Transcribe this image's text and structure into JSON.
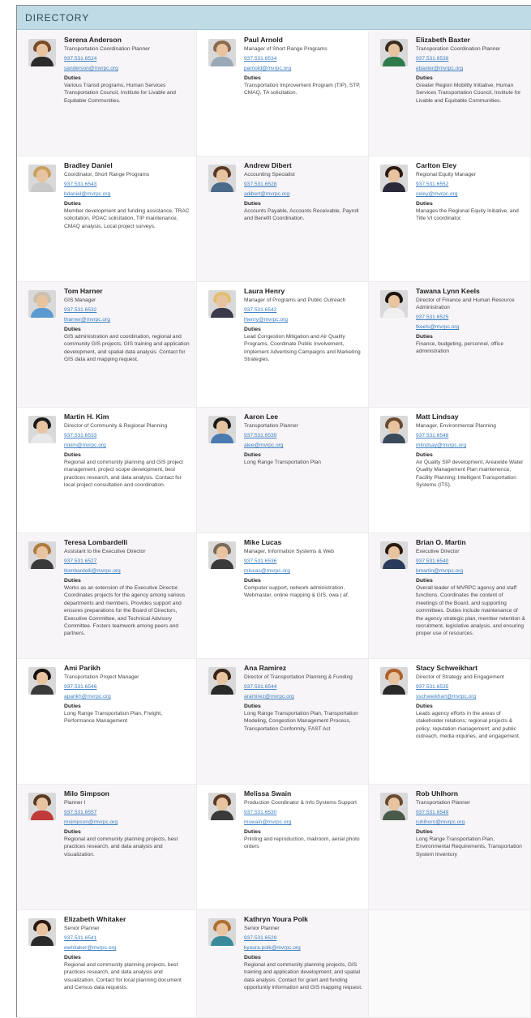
{
  "header": {
    "title": "DIRECTORY"
  },
  "people": [
    {
      "name": "Serena Anderson",
      "title": "Transportation Coordination Planner",
      "phone": "937.531.6524",
      "email": "sanderson@mvrpc.org",
      "duties_label": "Duties",
      "duties": "Various Transit programs, Human Services Transportation Council, Institute for Livable and Equitable Communities.",
      "hair": "#7a4a2a",
      "shirt": "#2b2b2b"
    },
    {
      "name": "Paul Arnold",
      "title": "Manager of Short Range Programs",
      "phone": "937.531.6534",
      "email": "parnold@mvrpc.org",
      "duties_label": "Duties",
      "duties": "Transportation Improvement Program (TIP), STP, CMAQ, TA solicitation.",
      "hair": "#8a6a50",
      "shirt": "#9aa9b8"
    },
    {
      "name": "Elizabeth Baxter",
      "title": "Transporation Coordination Planner",
      "phone": "937.531.6538",
      "email": "ebaxter@mvrpc.org",
      "duties_label": "Duties",
      "duties": "Greater Region Mobility Initiative, Human Services Transportation Council, Institute for Livable and Equitable Communities.",
      "hair": "#3a2a20",
      "shirt": "#2f7a4a"
    },
    {
      "name": "Bradley Daniel",
      "title": "Coordinator, Short Range Programs",
      "phone": "937.531.6543",
      "email": "bdaniel@mvrpc.org",
      "duties_label": "Duties",
      "duties": "Member development and funding assistance, TRAC solicitation, PDAC solicitation, TIP maintenance, CMAQ analysis, Local project surveys.",
      "hair": "#c9a060",
      "shirt": "#c9c9c9"
    },
    {
      "name": "Andrew Dibert",
      "title": "Accounting Specialist",
      "phone": "937.531.6528",
      "email": "adibert@mvrpc.org",
      "duties_label": "Duties",
      "duties": "Accounts Payable, Accounts Receivable, Payroll and Benefit Coordination.",
      "hair": "#5a3a25",
      "shirt": "#4a6a8a"
    },
    {
      "name": "Carlton Eley",
      "title": "Regional Equity Manager",
      "phone": "937.531.6552",
      "email": "celey@mvrpc.org",
      "duties_label": "Duties",
      "duties": "Manages the Regional Equity Initiative, and Title VI coordinator.",
      "hair": "#2a1a10",
      "shirt": "#2a2a3a"
    },
    {
      "name": "Tom Harner",
      "title": "GIS Manager",
      "phone": "937.531.6532",
      "email": "tharner@mvrpc.org",
      "duties_label": "Duties",
      "duties": "GIS administration and coordination, regional and community GIS projects, GIS training and application development, and spatial data analysis. Contact for GIS data and mapping request.",
      "hair": "#c8c0b0",
      "shirt": "#5a9ad0"
    },
    {
      "name": "Laura Henry",
      "title": "Manager of Programs and Public Outreach",
      "phone": "937.531.6542",
      "email": "lhenry@mvrpc.org",
      "duties_label": "Duties",
      "duties": "Lead Congestion Mitigation and Air Quality Programs, Coordinate Public Involvement, Implement Advertising Campaigns and Marketing Strategies.",
      "hair": "#e0c070",
      "shirt": "#3a3a4a"
    },
    {
      "name": "Tawana Lynn Keels",
      "title": "Director of Finance and Human Resource Administration",
      "phone": "937.531.6525",
      "email": "tkeels@mvrpc.org",
      "duties_label": "Duties",
      "duties": "Finance, budgeting, personnel, office administration",
      "hair": "#1e1410",
      "shirt": "#f0f0f0"
    },
    {
      "name": "Martin H. Kim",
      "title": "Director of Community & Regional Planning",
      "phone": "937.531.6533",
      "email": "mkim@mvrpc.org",
      "duties_label": "Duties",
      "duties": "Regional and community planning and GIS project management, project scope development, best practices research, and data analysis. Contact for local project consultation and coordination.",
      "hair": "#1a1a1a",
      "shirt": "#e8e8e8"
    },
    {
      "name": "Aaron Lee",
      "title": "Transportation Planner",
      "phone": "937.531.6539",
      "email": "alee@mvrpc.org",
      "duties_label": "Duties",
      "duties": "Long Range Transportation Plan",
      "hair": "#1a1a1a",
      "shirt": "#4a7ab0"
    },
    {
      "name": "Matt Lindsay",
      "title": "Manager, Environmental Planning",
      "phone": "937.531.6548",
      "email": "mlindsay@mvrpc.org",
      "duties_label": "Duties",
      "duties": "Air Quality SIP development, Areawide Water Quality Management Plan maintenence, Facility Planning; Intelligent Transportation Systems (ITS).",
      "hair": "#6a4a30",
      "shirt": "#3a4a5a"
    },
    {
      "name": "Teresa Lombardelli",
      "title": "Assistant to the Executive Director",
      "phone": "937.531.6527",
      "email": "tlombardelli@mvrpc.org",
      "duties_label": "Duties",
      "duties": "Works as an extension of the Executive Director. Coordinates projects for the agency among various departments and members. Provides support and ensures preparations for the Board of Directors, Executive Committee, and Technical Advisory Committee. Fosters teamwork among peers and partners.",
      "hair": "#b07a40",
      "shirt": "#3a3a3a"
    },
    {
      "name": "Mike Lucas",
      "title": "Manager, Information Systems & Web",
      "phone": "937.531.6536",
      "email": "mlucas@mvrpc.org",
      "duties_label": "Duties",
      "duties": "Computer support, network administration, Webmaster, online mapping & GIS, owa | af.",
      "hair": "#7a6a5a",
      "shirt": "#3a3a3a"
    },
    {
      "name": "Brian O. Martin",
      "title": "Executive Director",
      "phone": "937.531.6540",
      "email": "bmartin@mvrpc.org",
      "duties_label": "Duties",
      "duties": "Overall leader of MVRPC agency and staff functions. Coordinates the content of meetings of the Board, and supporting committees. Duties include maintenance of the agency strategic plan, member retention & recruitment, legislative analysis, and ensuring proper use of resources.",
      "hair": "#2a1a10",
      "shirt": "#2a3a5a"
    },
    {
      "name": "Ami Parikh",
      "title": "Transportation Project Manager",
      "phone": "937.531.6546",
      "email": "aparikh@mvrpc.org",
      "duties_label": "Duties",
      "duties": "Long Range Transportation Plan, Freight, Performance Management",
      "hair": "#1a1210",
      "shirt": "#3a3a3a"
    },
    {
      "name": "Ana Ramirez",
      "title": "Director of Transportation Planning & Funding",
      "phone": "937.531.6544",
      "email": "aramirez@mvrpc.org",
      "duties_label": "Duties",
      "duties": "Long Range Transportation Plan, Transportation Modeling, Congestion Management Process, Transportation Conformity, FAST Act",
      "hair": "#3a2418",
      "shirt": "#2a2a2a"
    },
    {
      "name": "Stacy Schweikhart",
      "title": "Director of Strategy and Engagement",
      "phone": "937.531.6535",
      "email": "sschweikhart@mvrpc.org",
      "duties_label": "Duties",
      "duties": "Leads agency efforts in the areas of stakeholder relations; regional projects & policy; reputation management; and public outreach, media inquiries, and engagement.",
      "hair": "#b0602a",
      "shirt": "#2a2a2a"
    },
    {
      "name": "Milo Simpson",
      "title": "Planner I",
      "phone": "937.531.6557",
      "email": "msimpson@mvrpc.org",
      "duties_label": "Duties",
      "duties": "Regional and community planning projects, best practices research, and data analysis and visualization.",
      "hair": "#5a3a20",
      "shirt": "#c03a3a"
    },
    {
      "name": "Melissa Swain",
      "title": "Production Coordinator & Info Systems Support",
      "phone": "937.531.6530",
      "email": "mswain@mvrpc.org",
      "duties_label": "Duties",
      "duties": "Printing and reproduction, mailroom, aerial photo orders",
      "hair": "#5a3a25",
      "shirt": "#3a3a3a"
    },
    {
      "name": "Rob Uhlhorn",
      "title": "Transportation Planner",
      "phone": "937.531.6549",
      "email": "ruhlhorn@mvrpc.org",
      "duties_label": "Duties",
      "duties": "Long Range Transportation Plan, Environmental Requirements, Transportation System Inventory",
      "hair": "#6a4a30",
      "shirt": "#4a5a4a"
    },
    {
      "name": "Elizabeth Whitaker",
      "title": "Senior Planner",
      "phone": "937.531.6541",
      "email": "ewhitaker@mvrpc.org",
      "duties_label": "Duties",
      "duties": "Regional and community planning projects, best practices research, and data analysis and visualization. Contact for local planning document and Census data requests.",
      "hair": "#2a1a12",
      "shirt": "#2a2a2a"
    },
    {
      "name": "Kathryn Youra Polk",
      "title": "Senior Planner",
      "phone": "937.531.6529",
      "email": "kyoura.polk@mvrpc.org",
      "duties_label": "Duties",
      "duties": "Regional and community planning projects, GIS training and application development; and spatial data analysis. Contact for grant and funding opportunity information and GIS mapping request.",
      "hair": "#b07030",
      "shirt": "#3a8a9a"
    }
  ]
}
